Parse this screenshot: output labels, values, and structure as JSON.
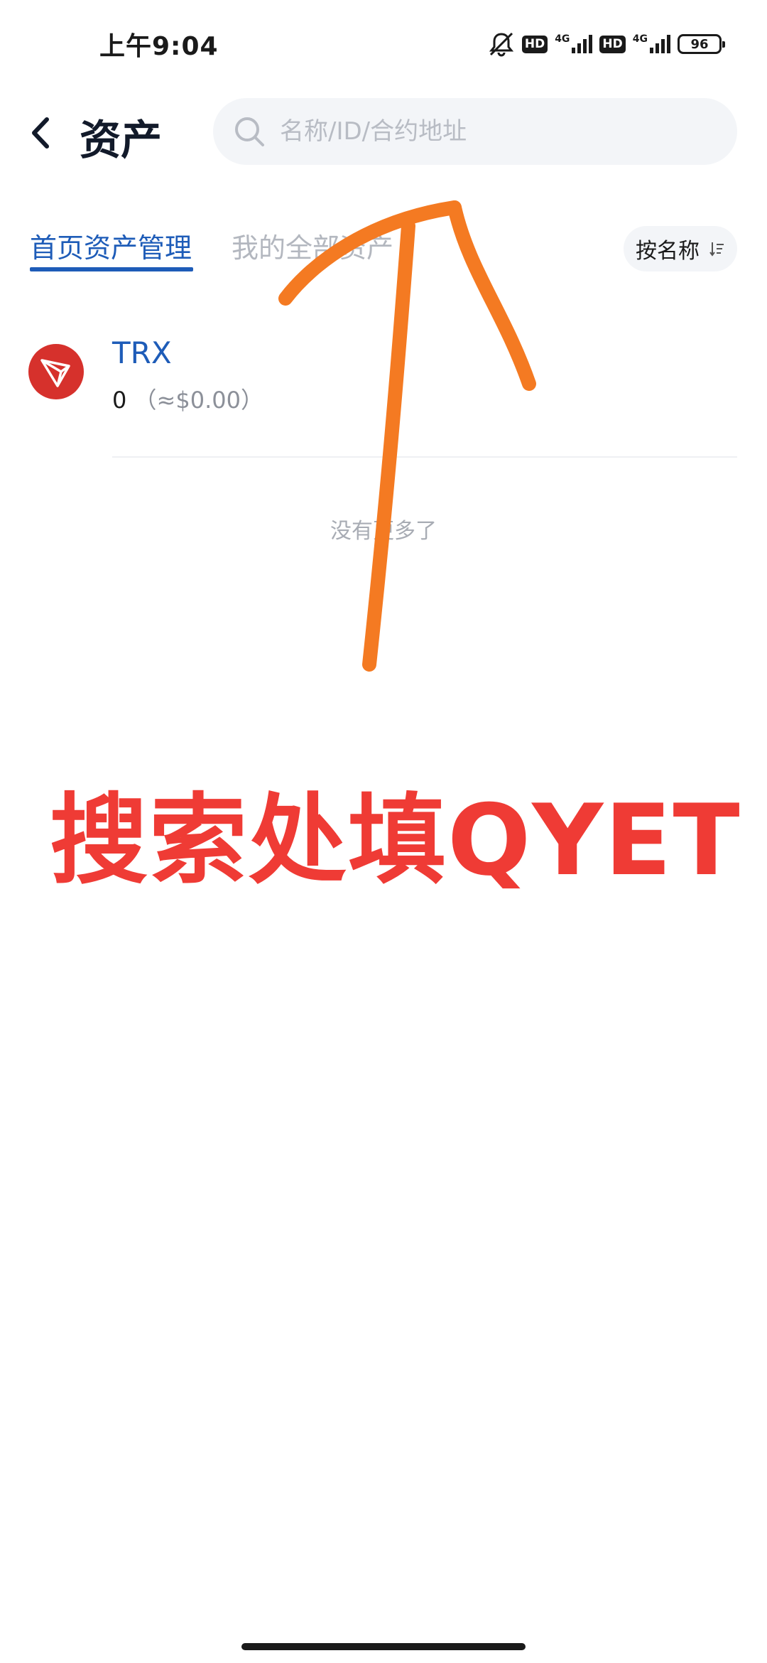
{
  "status_bar": {
    "time": "上午9:04",
    "hd_1": "HD",
    "net_1": "4G",
    "hd_2": "HD",
    "net_2": "4G",
    "battery": "96"
  },
  "header": {
    "title": "资产",
    "back_icon": "chevron-left-icon",
    "search": {
      "placeholder": "名称/ID/合约地址",
      "value": ""
    }
  },
  "tabs": [
    {
      "label": "首页资产管理",
      "active": true
    },
    {
      "label": "我的全部资产",
      "active": false
    }
  ],
  "sort": {
    "label": "按名称",
    "icon": "sort-icon"
  },
  "assets": [
    {
      "name": "TRX",
      "balance": "0",
      "fiat": "（≈$0.00）",
      "logo": "tron-logo-icon"
    }
  ],
  "list_footer": "没有更多了",
  "annotation": {
    "text": "搜索处填QYET",
    "text_color": "#ef3b35",
    "arrow_color": "#f47a22"
  },
  "colors": {
    "accent": "#1e5cb8",
    "tron_red": "#d6312c"
  }
}
